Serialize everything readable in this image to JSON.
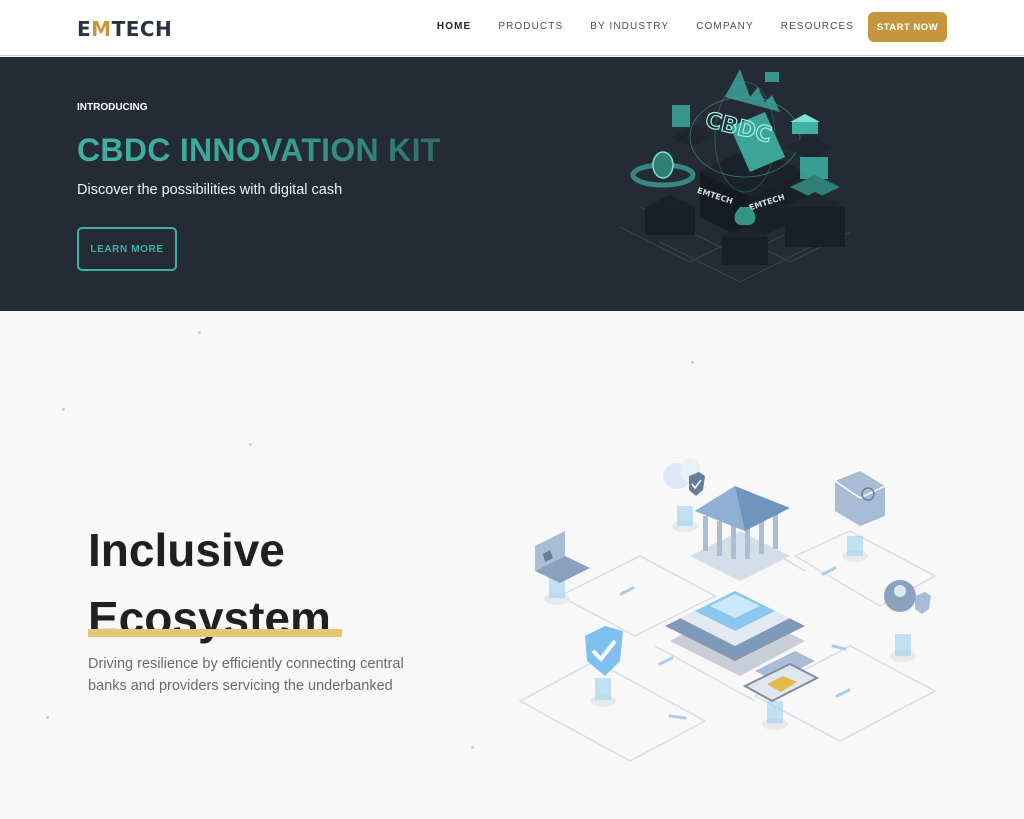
{
  "nav": {
    "logo": {
      "prefix": "E",
      "accent": "M",
      "suffix": "TECH"
    },
    "links": [
      {
        "label": "HOME",
        "active": true
      },
      {
        "label": "PRODUCTS",
        "active": false
      },
      {
        "label": "BY INDUSTRY",
        "active": false
      },
      {
        "label": "COMPANY",
        "active": false
      },
      {
        "label": "RESOURCES",
        "active": false
      }
    ],
    "cta_label": "START NOW"
  },
  "hero": {
    "eyebrow": "INTRODUCING",
    "title": "CBDC INNOVATION KIT",
    "subtitle": "Discover the possibilities with digital cash",
    "button_label": "LEARN MORE",
    "illustration": {
      "label": "CBDC",
      "brand_marks": [
        "EMTECH",
        "EMTECH"
      ],
      "icons": [
        "coin-icon",
        "bank-icon",
        "chart-icon",
        "laptop-icon",
        "plant-icon",
        "cbdc-laptop-icon"
      ]
    }
  },
  "ecosystem": {
    "title_line1": "Inclusive",
    "title_line2": "Ecosystem",
    "description": "Driving resilience by efficiently connecting central banks and providers servicing the underbanked",
    "illustration": {
      "icons": [
        "bank-icon",
        "cloud-shield-icon",
        "email-icon",
        "laptop-icon",
        "shield-check-icon",
        "user-shield-icon",
        "card-phone-icon"
      ]
    }
  },
  "colors": {
    "brand_gold": "#c6963f",
    "accent_teal": "#3fb1a3",
    "hero_bg": "#242b35",
    "underline_gold": "#e4c770"
  }
}
